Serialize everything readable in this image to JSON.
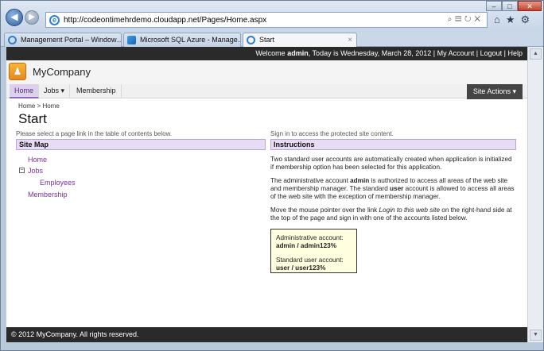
{
  "browser": {
    "url": "http://codeontimehrdemo.cloudapp.net/Pages/Home.aspx",
    "tabs": [
      {
        "label": "Management Portal – Window…"
      },
      {
        "label": "Microsoft SQL Azure - Manage…"
      },
      {
        "label": "Start"
      }
    ],
    "tab_close": "×"
  },
  "topbar": {
    "welcome": "Welcome",
    "user": "admin",
    "date_text": ", Today is Wednesday, March 28, 2012 |",
    "my_account": "My Account",
    "sep1": "|",
    "logout": "Logout",
    "sep2": "|",
    "help": "Help"
  },
  "brand": {
    "company": "MyCompany"
  },
  "menu": {
    "home": "Home",
    "jobs": "Jobs",
    "membership": "Membership",
    "site_actions": "Site Actions"
  },
  "breadcrumb": {
    "text": "Home > Home"
  },
  "page_title": "Start",
  "left": {
    "intro": "Please select a page link in the table of contents below.",
    "heading": "Site Map",
    "items": {
      "home": "Home",
      "jobs": "Jobs",
      "employees": "Employees",
      "membership": "Membership"
    }
  },
  "right": {
    "intro": "Sign in to access the protected site content.",
    "heading": "Instructions",
    "p1": "Two standard user accounts are automatically created when application is initialized if membership option has been selected for this application.",
    "p2_a": "The administrative account ",
    "p2_b": "admin",
    "p2_c": " is authorized to access all areas of the web site and membership manager. The standard ",
    "p2_d": "user",
    "p2_e": " account is allowed to access all areas of the web site with the exception of membership manager.",
    "p3_a": "Move the mouse pointer over the link ",
    "p3_b": "Login to this web site",
    "p3_c": " on the right-hand side at the top of the page and sign in with one of the accounts listed below.",
    "creds": {
      "admin_label": "Administrative account:",
      "admin_value": "admin / admin123%",
      "user_label": "Standard user account:",
      "user_value": "user / user123%"
    }
  },
  "footer": {
    "text": "© 2012 MyCompany. All rights reserved."
  }
}
